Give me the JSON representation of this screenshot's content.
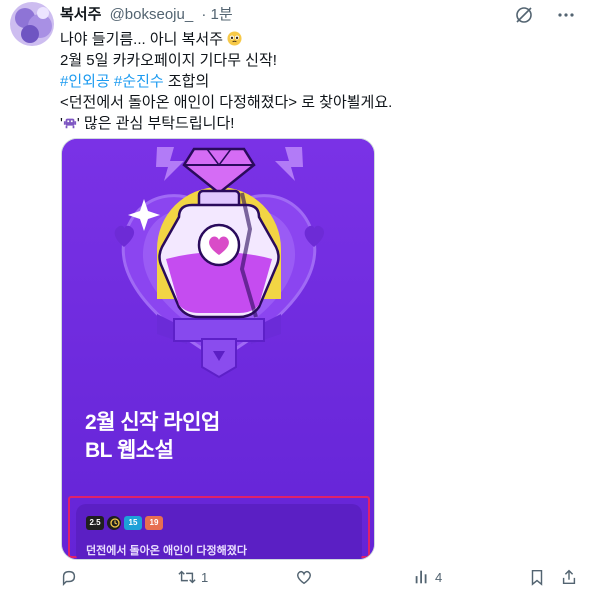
{
  "author": {
    "display_name": "복서주",
    "handle": "@bokseoju_",
    "time": "· 1분"
  },
  "icons": {
    "avatar": "avatar-illustration",
    "grok": "grok-icon",
    "more": "more-icon",
    "alien": "alien-monster-emoji",
    "pleading": "pleading-face-emoji"
  },
  "tweet": {
    "line1_prefix": "나야 들기름... 아니 복서주",
    "line2": "2월 5일 카카오페이지 기다무 신작!",
    "hashtag1": "#인외공",
    "hashtag2": "#순진수",
    "line3_suffix": " 조합의",
    "line4": "<던전에서 돌아온 애인이 다정해졌다> 로 찾아뵐게요.",
    "line5_open": "'",
    "line5_close": "' 많은 관심 부탁드립니다!"
  },
  "media": {
    "headline_line1": "2월 신작 라인업",
    "headline_line2": "BL 웹소설",
    "badges": [
      "2.5",
      "",
      "15",
      "19"
    ],
    "book_title": "던전에서 돌아온 애인이 다정해졌다"
  },
  "actions": {
    "reply_count": "",
    "retweet_count": "1",
    "like_count": "",
    "views_count": "4"
  },
  "colors": {
    "accent": "#1d9bf0",
    "text": "#0f1419",
    "muted": "#536471",
    "media_bg": "#6d28d9",
    "highlight_border": "#e0216a"
  }
}
